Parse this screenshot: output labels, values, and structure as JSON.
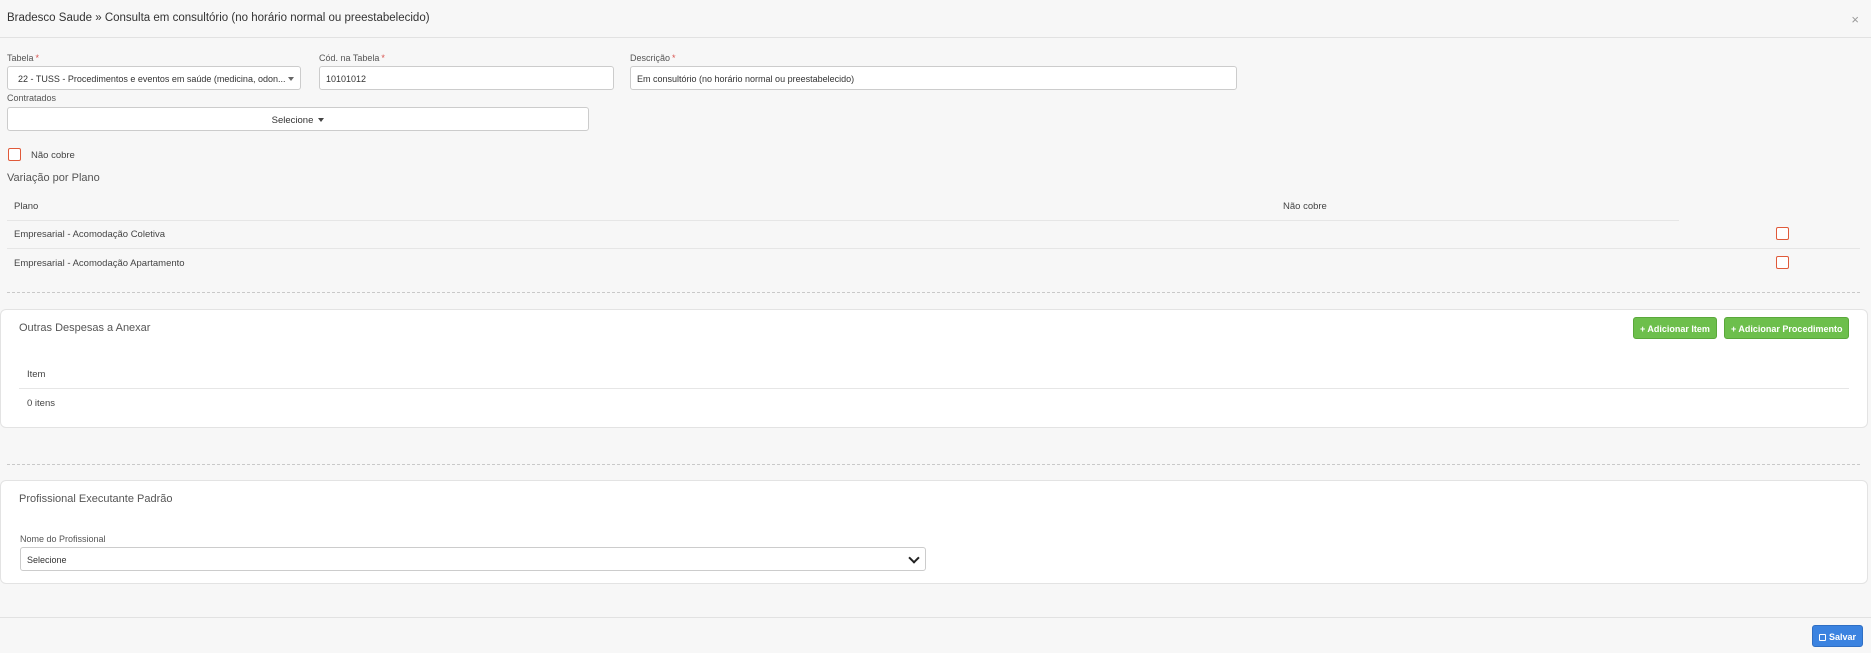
{
  "header": {
    "title": "Bradesco Saude » Consulta em consultório (no horário normal ou preestabelecido)",
    "close_glyph": "×"
  },
  "form": {
    "tabela": {
      "label": "Tabela",
      "required": "*",
      "value": "22 - TUSS - Procedimentos e eventos em saúde (medicina, odon..."
    },
    "cod_tabela": {
      "label": "Cód. na Tabela",
      "required": "*",
      "value": "10101012"
    },
    "descricao": {
      "label": "Descrição",
      "required": "*",
      "value": "Em consultório (no horário normal ou preestabelecido)"
    },
    "contratados": {
      "label": "Contratados",
      "button": "Selecione"
    },
    "nao_cobre": {
      "label": "Não cobre"
    }
  },
  "variacao": {
    "title": "Variação por Plano",
    "columns": {
      "plano": "Plano",
      "nao_cobre": "Não cobre"
    },
    "rows": [
      {
        "plano": "Empresarial - Acomodação Coletiva"
      },
      {
        "plano": "Empresarial - Acomodação Apartamento"
      }
    ]
  },
  "outras_despesas": {
    "title": "Outras Despesas a Anexar",
    "add_item": "+ Adicionar Item",
    "add_procedimento": "+ Adicionar Procedimento",
    "column_item": "Item",
    "count": "0 itens"
  },
  "profissional": {
    "title": "Profissional Executante Padrão",
    "label": "Nome do Profissional",
    "value": "Selecione"
  },
  "footer": {
    "save": "Salvar"
  },
  "colors": {
    "green": "#6dbf4c",
    "blue": "#3b83e0",
    "checkbox_border": "#e05a3a",
    "required": "#d9534f"
  }
}
